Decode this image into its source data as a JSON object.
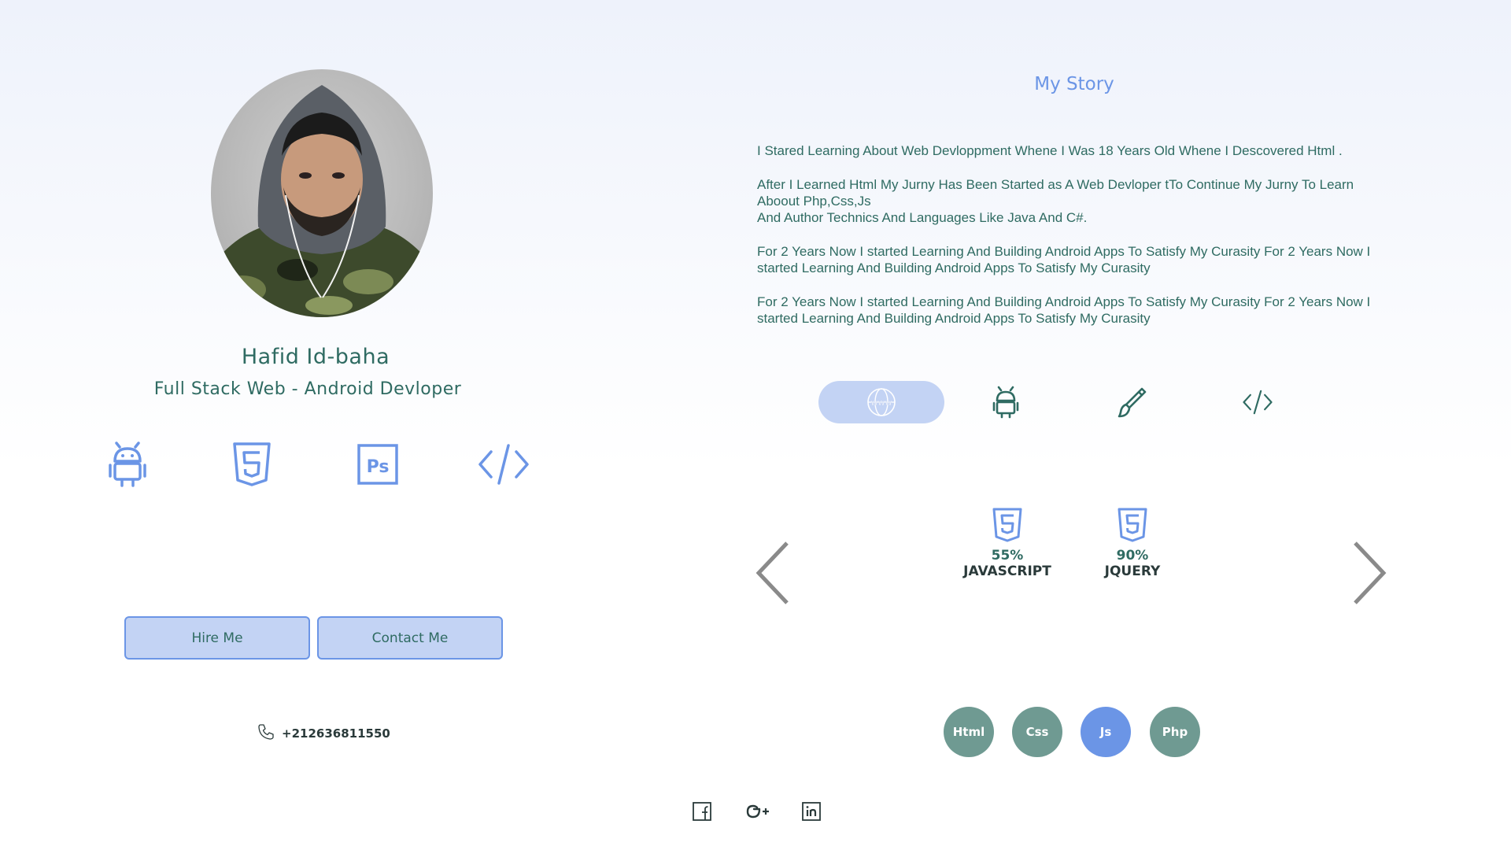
{
  "profile": {
    "name": "Hafid Id-baha",
    "role": "Full Stack Web - Android Devloper",
    "skill_icons": [
      "android-icon",
      "html5-icon",
      "photoshop-icon",
      "code-icon"
    ],
    "buttons": {
      "hire": "Hire Me",
      "contact": "Contact Me"
    },
    "phone": "+212636811550"
  },
  "story": {
    "title": "My Story",
    "paragraphs": [
      "I Stared Learning  About Web Devloppment Whene I Was 18 Years Old Whene I Descovered Html .",
      "After I Learned Html My Jurny Has Been  Started as A Web Devloper  tTo Continue My Jurny To Learn Aboout Php,Css,Js\nAnd Author Technics And Languages Like Java And C#.",
      "For 2 Years Now I started Learning And Building Android Apps To Satisfy My Curasity  For 2 Years Now I started Learning And Building Android Apps To Satisfy My Curasity",
      "For 2 Years Now I started Learning And Building Android Apps To Satisfy My Curasity  For 2 Years Now I started Learning And Building Android Apps To Satisfy My Curasity"
    ]
  },
  "categories": [
    {
      "icon": "www-globe-icon",
      "active": true
    },
    {
      "icon": "android-icon",
      "active": false
    },
    {
      "icon": "brush-icon",
      "active": false
    },
    {
      "icon": "code-icon",
      "active": false
    }
  ],
  "skills": [
    {
      "icon": "html5-icon",
      "percent": "55%",
      "label": "JAVASCRIPT"
    },
    {
      "icon": "html5-icon",
      "percent": "90%",
      "label": "JQUERY"
    }
  ],
  "skill_tabs": [
    {
      "label": "Html",
      "active": false
    },
    {
      "label": "Css",
      "active": false
    },
    {
      "label": "Js",
      "active": true
    },
    {
      "label": "Php",
      "active": false
    }
  ],
  "socials": [
    "facebook-icon",
    "google-plus-icon",
    "linkedin-icon"
  ],
  "colors": {
    "accent_blue": "#6b95e6",
    "light_blue": "#c3d3f4",
    "teal_text": "#2f6b62",
    "teal_dot": "#6f9a92"
  }
}
